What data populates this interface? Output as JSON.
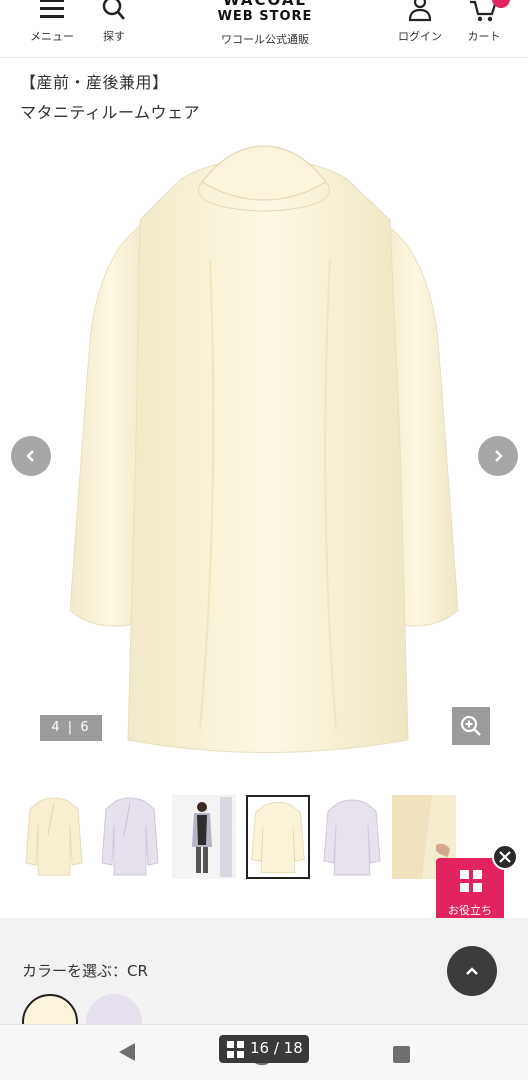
{
  "header": {
    "menu_label": "メニュー",
    "search_label": "探す",
    "brand": "WACOAL",
    "store": "WEB STORE",
    "tagline": "ワコール公式通販",
    "login_label": "ログイン",
    "cart_label": "カート"
  },
  "product": {
    "title_line1": "【産前・産後兼用】",
    "title_line2": "マタニティルームウェア"
  },
  "gallery": {
    "counter": "4 | 6",
    "thumbnails": [
      {
        "name": "thumb-cream-front"
      },
      {
        "name": "thumb-lavender-front"
      },
      {
        "name": "thumb-model"
      },
      {
        "name": "thumb-cream-back",
        "selected": true
      },
      {
        "name": "thumb-lavender-back"
      },
      {
        "name": "thumb-detail"
      }
    ]
  },
  "help": {
    "label": "お役立ち"
  },
  "color": {
    "label": "カラーを選ぶ：CR",
    "swatches": [
      {
        "code": "CR",
        "hex": "#fbf3dc",
        "selected": true
      },
      {
        "code": "LAV",
        "hex": "#e6e0ee",
        "selected": false
      }
    ]
  },
  "system": {
    "page_indicator": "16 / 18"
  },
  "colors": {
    "accent": "#e2235f",
    "garment": "#fbf5de",
    "overlay_gray": "#9b9b9b"
  }
}
